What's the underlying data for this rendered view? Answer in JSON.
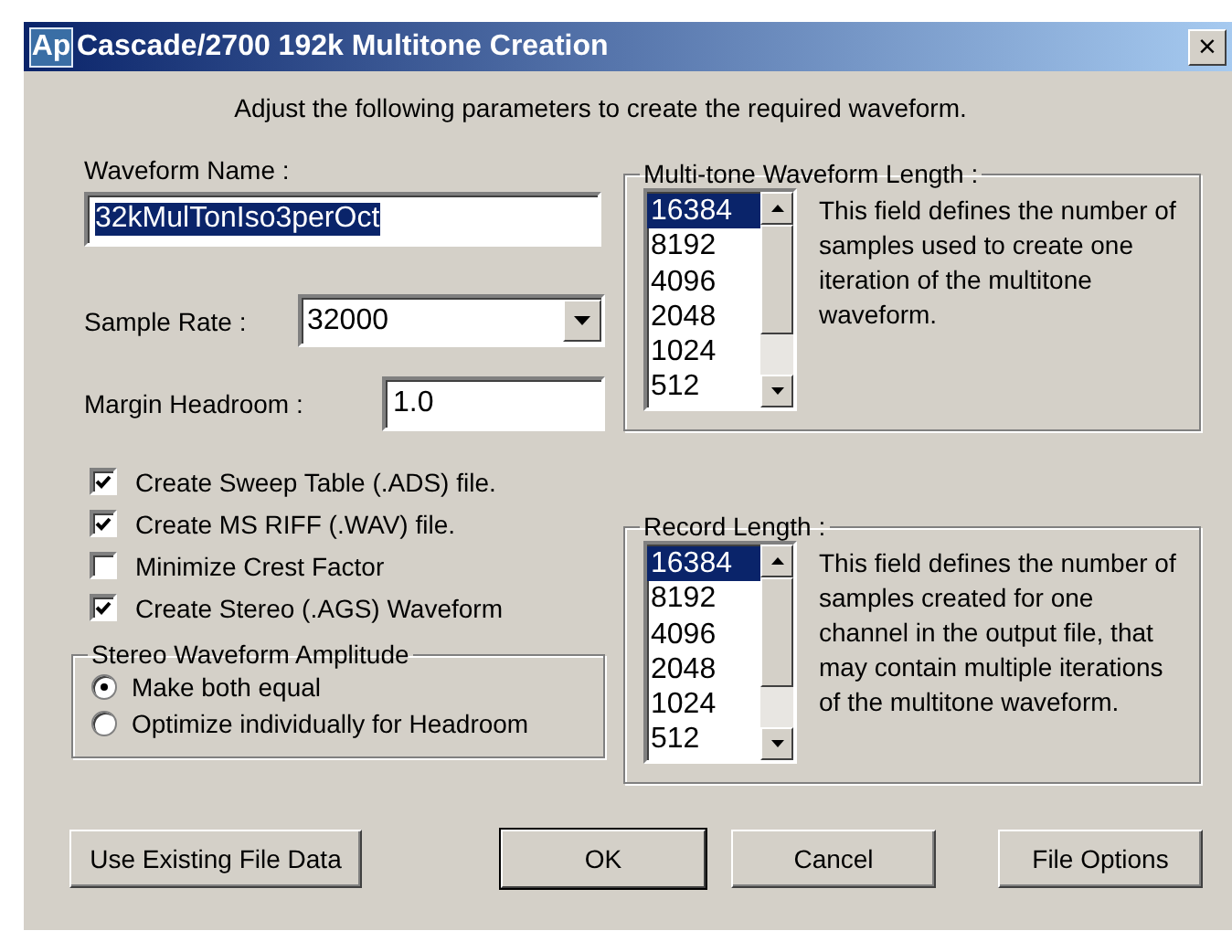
{
  "window": {
    "app_icon": "Ap",
    "title": "Cascade/2700 192k Multitone Creation",
    "close": "×"
  },
  "instructions": "Adjust the following parameters to create the required waveform.",
  "waveform_name": {
    "label": "Waveform Name :",
    "value": "32kMulTonIso3perOct",
    "text_selected": true
  },
  "sample_rate": {
    "label": "Sample Rate :",
    "value": "32000"
  },
  "margin_headroom": {
    "label": "Margin Headroom :",
    "value": "1.0"
  },
  "options": [
    {
      "label": "Create Sweep Table (.ADS) file.",
      "checked": true
    },
    {
      "label": "Create MS RIFF (.WAV) file.",
      "checked": true
    },
    {
      "label": "Minimize Crest Factor",
      "checked": false
    },
    {
      "label": "Create Stereo (.AGS) Waveform",
      "checked": true
    }
  ],
  "stereo_amplitude": {
    "title": "Stereo Waveform Amplitude",
    "options": [
      {
        "label": "Make both equal",
        "selected": true
      },
      {
        "label": "Optimize individually for Headroom",
        "selected": false
      }
    ]
  },
  "length_groups": [
    {
      "title": "Multi-tone Waveform Length :",
      "description": "This field defines the number of samples used to create one iteration of the multitone waveform.",
      "items": [
        {
          "label": "16384",
          "selected": true
        },
        {
          "label": "8192",
          "selected": false
        },
        {
          "label": "4096",
          "selected": false
        },
        {
          "label": "2048",
          "selected": false
        },
        {
          "label": "1024",
          "selected": false
        },
        {
          "label": "512",
          "selected": false
        }
      ]
    },
    {
      "title": "Record Length :",
      "description": "This field defines the number of samples created for one channel in the output file, that may contain multiple iterations of the multitone waveform.",
      "items": [
        {
          "label": "16384",
          "selected": true
        },
        {
          "label": "8192",
          "selected": false
        },
        {
          "label": "4096",
          "selected": false
        },
        {
          "label": "2048",
          "selected": false
        },
        {
          "label": "1024",
          "selected": false
        },
        {
          "label": "512",
          "selected": false
        }
      ]
    }
  ],
  "buttons": [
    {
      "label": "Use Existing File Data",
      "default": false
    },
    {
      "label": "OK",
      "default": true
    },
    {
      "label": "Cancel",
      "default": false
    },
    {
      "label": "File Options",
      "default": false
    }
  ]
}
